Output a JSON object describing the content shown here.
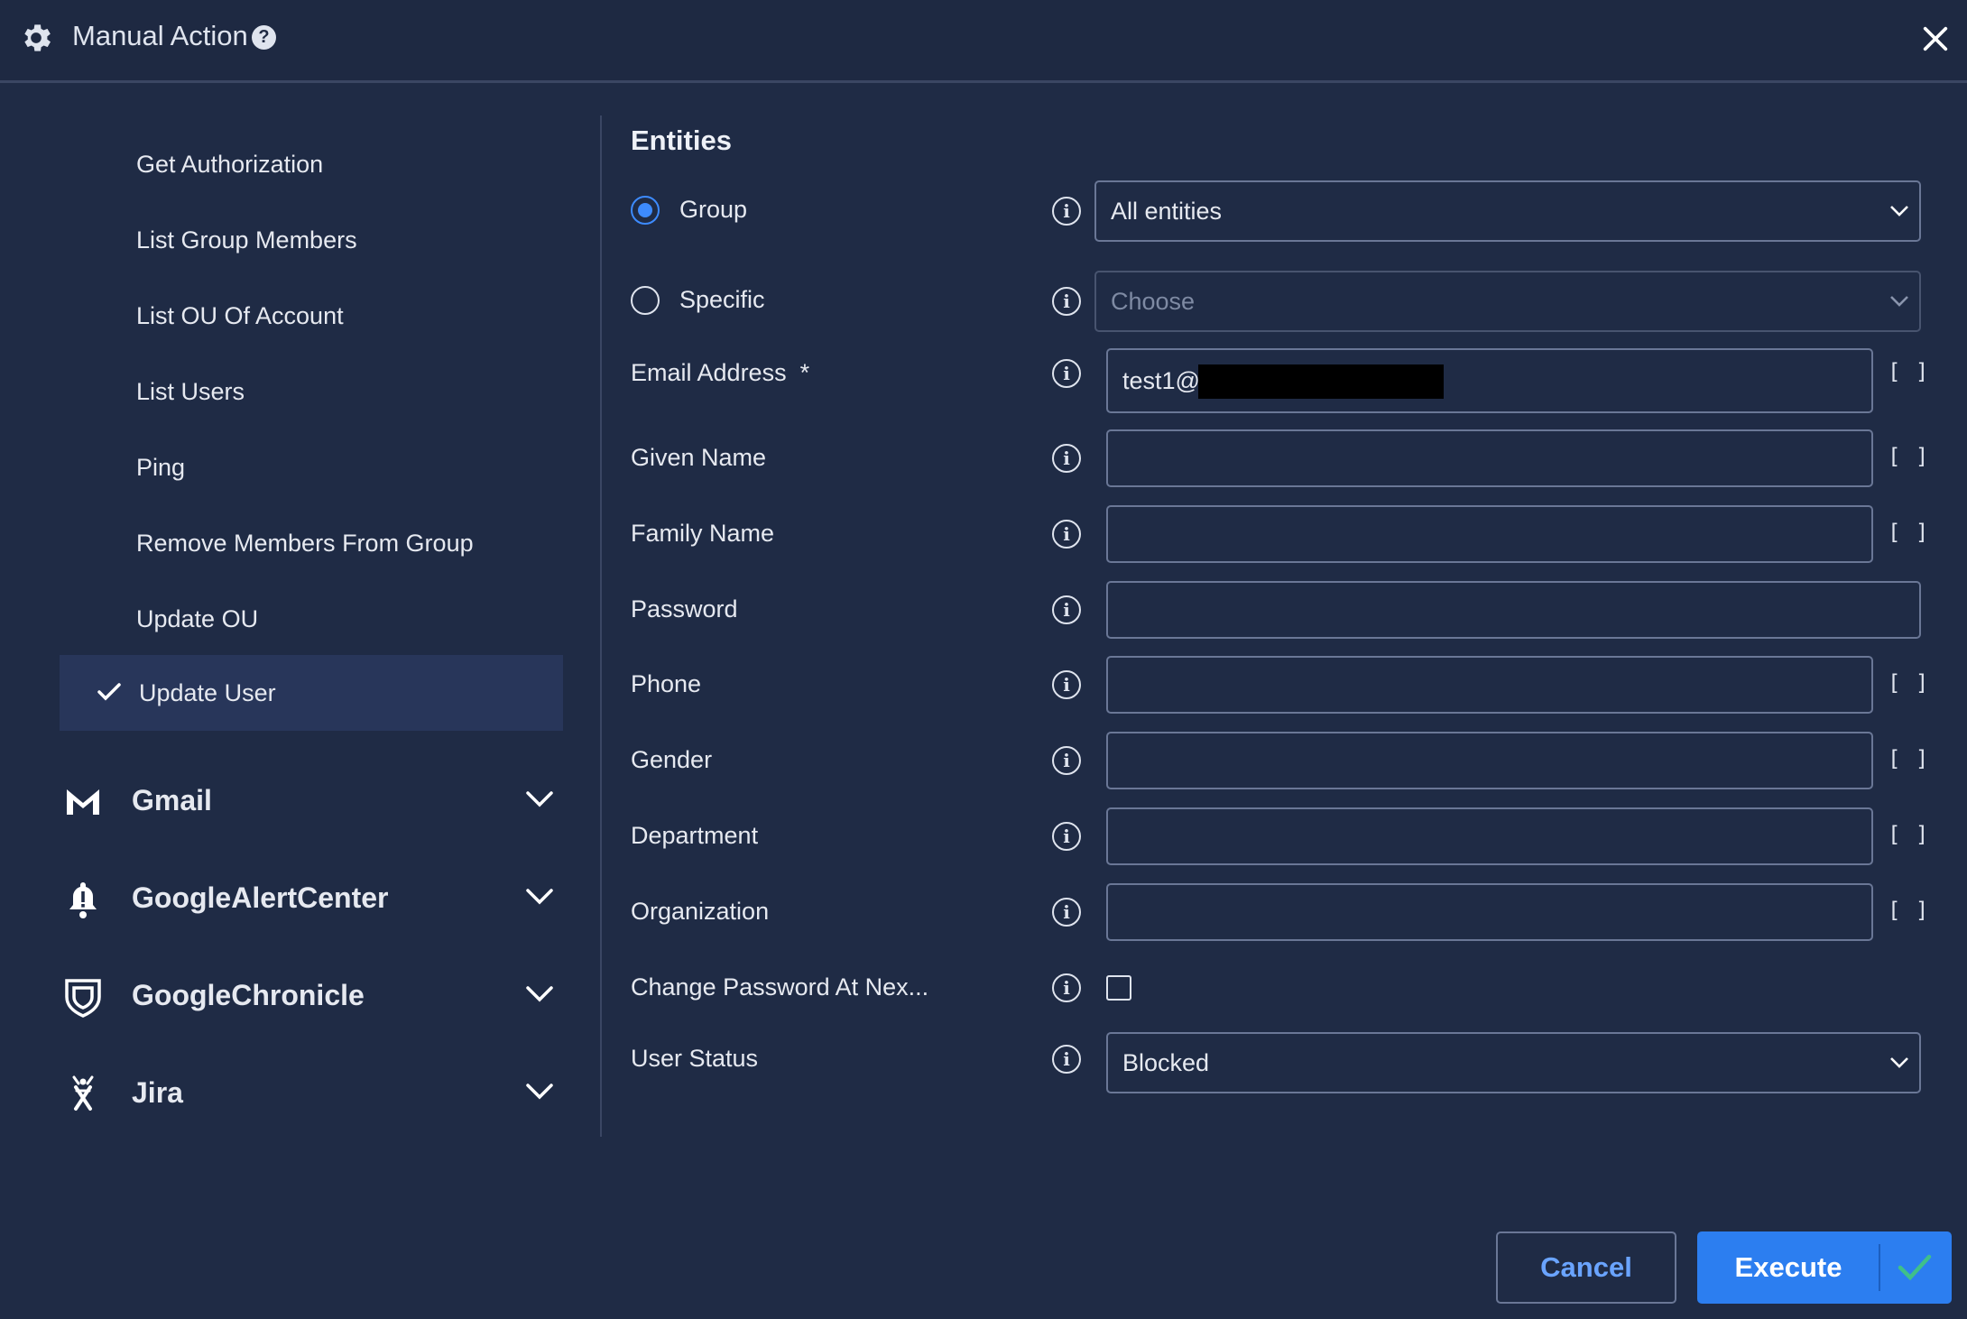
{
  "header": {
    "title": "Manual Action",
    "help_glyph": "?",
    "icons": [
      "gear-icon",
      "help-icon",
      "close-icon"
    ]
  },
  "sidebar": {
    "items": [
      {
        "label": "Get Authorization",
        "active": false
      },
      {
        "label": "List Group Members",
        "active": false
      },
      {
        "label": "List OU Of Account",
        "active": false
      },
      {
        "label": "List Users",
        "active": false
      },
      {
        "label": "Ping",
        "active": false
      },
      {
        "label": "Remove Members From Group",
        "active": false
      },
      {
        "label": "Update OU",
        "active": false
      },
      {
        "label": "Update User",
        "active": true
      }
    ],
    "groups": [
      {
        "label": "Gmail",
        "icon": "gmail-icon"
      },
      {
        "label": "GoogleAlertCenter",
        "icon": "bell-icon"
      },
      {
        "label": "GoogleChronicle",
        "icon": "shield-icon"
      },
      {
        "label": "Jira",
        "icon": "jira-icon"
      }
    ]
  },
  "main": {
    "section_title": "Entities",
    "entities": {
      "group_label": "Group",
      "group_selected": true,
      "group_value": "All entities",
      "specific_label": "Specific",
      "specific_placeholder": "Choose"
    },
    "info_glyph": "i",
    "brackets_glyph": "[ ]",
    "fields": {
      "email": {
        "label": "Email Address",
        "required_mark": "*",
        "value": "test1@"
      },
      "given_name": {
        "label": "Given Name",
        "value": ""
      },
      "family_name": {
        "label": "Family Name",
        "value": ""
      },
      "password": {
        "label": "Password",
        "value": ""
      },
      "phone": {
        "label": "Phone",
        "value": ""
      },
      "gender": {
        "label": "Gender",
        "value": ""
      },
      "department": {
        "label": "Department",
        "value": ""
      },
      "organization": {
        "label": "Organization",
        "value": ""
      },
      "change_password": {
        "label": "Change Password At Nex...",
        "checked": false
      },
      "user_status": {
        "label": "User Status",
        "value": "Blocked"
      }
    }
  },
  "footer": {
    "cancel_label": "Cancel",
    "execute_label": "Execute"
  },
  "colors": {
    "background": "#1f2b45",
    "accent": "#3d8bff",
    "execute_button": "#2c7ef0",
    "cancel_text": "#6aa4ff",
    "check_green": "#3fc08a"
  }
}
